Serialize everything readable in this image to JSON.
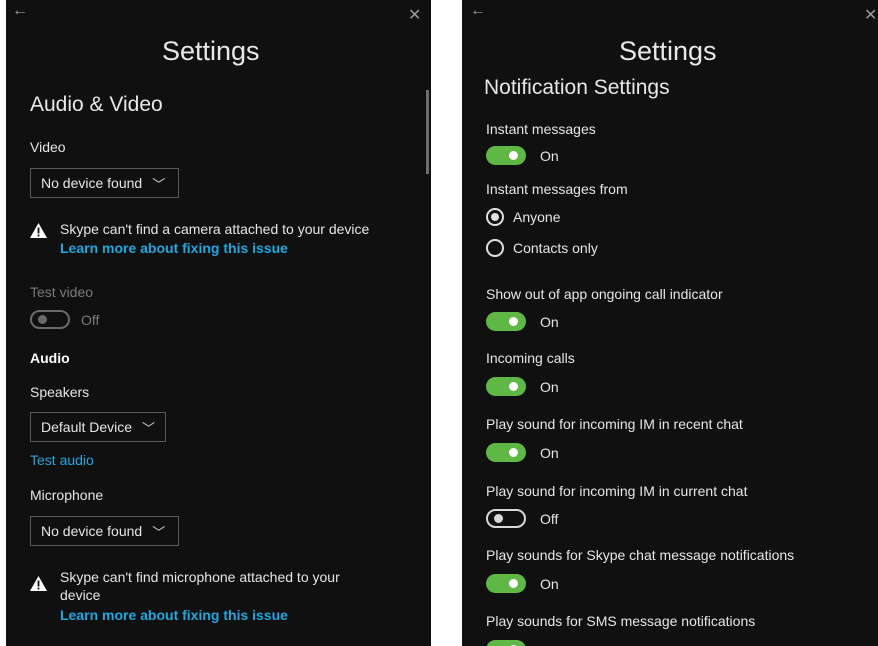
{
  "left": {
    "back_glyph": "←",
    "close_glyph": "✕",
    "title": "Settings",
    "section": "Audio & Video",
    "video_label": "Video",
    "video_device": "No device found",
    "camera_warning": "Skype can't find a camera attached to your device",
    "camera_link": "Learn more about fixing this issue",
    "test_video_label": "Test video",
    "test_video_state": "Off",
    "audio_heading": "Audio",
    "speakers_label": "Speakers",
    "speakers_device": "Default Device",
    "test_audio_link": "Test audio",
    "microphone_label": "Microphone",
    "microphone_device": "No device found",
    "mic_warning_line1": "Skype can't find microphone attached to your",
    "mic_warning_line2": "device",
    "mic_link": "Learn more about fixing this issue"
  },
  "right": {
    "back_glyph": "←",
    "close_glyph": "✕",
    "title": "Settings",
    "section": "Notification Settings",
    "instant_messages_label": "Instant messages",
    "instant_messages_state": "On",
    "im_from_label": "Instant messages from",
    "radio_anyone": "Anyone",
    "radio_contacts": "Contacts only",
    "selected_radio": "Anyone",
    "call_indicator_label": "Show out of app ongoing call indicator",
    "call_indicator_state": "On",
    "incoming_calls_label": "Incoming calls",
    "incoming_calls_state": "On",
    "sound_recent_label": "Play sound for incoming IM in recent chat",
    "sound_recent_state": "On",
    "sound_current_label": "Play sound for incoming IM in current chat",
    "sound_current_state": "Off",
    "sound_skype_label": "Play sounds for Skype chat message notifications",
    "sound_skype_state": "On",
    "sound_sms_label": "Play sounds for SMS message notifications"
  },
  "colors": {
    "panel_bg": "#101010",
    "toggle_on": "#5fb845",
    "link": "#1ea8e0"
  },
  "icons": {
    "warning": "warning-triangle-icon",
    "chevron": "chevron-down-icon",
    "back": "back-arrow-icon",
    "close": "close-icon"
  }
}
